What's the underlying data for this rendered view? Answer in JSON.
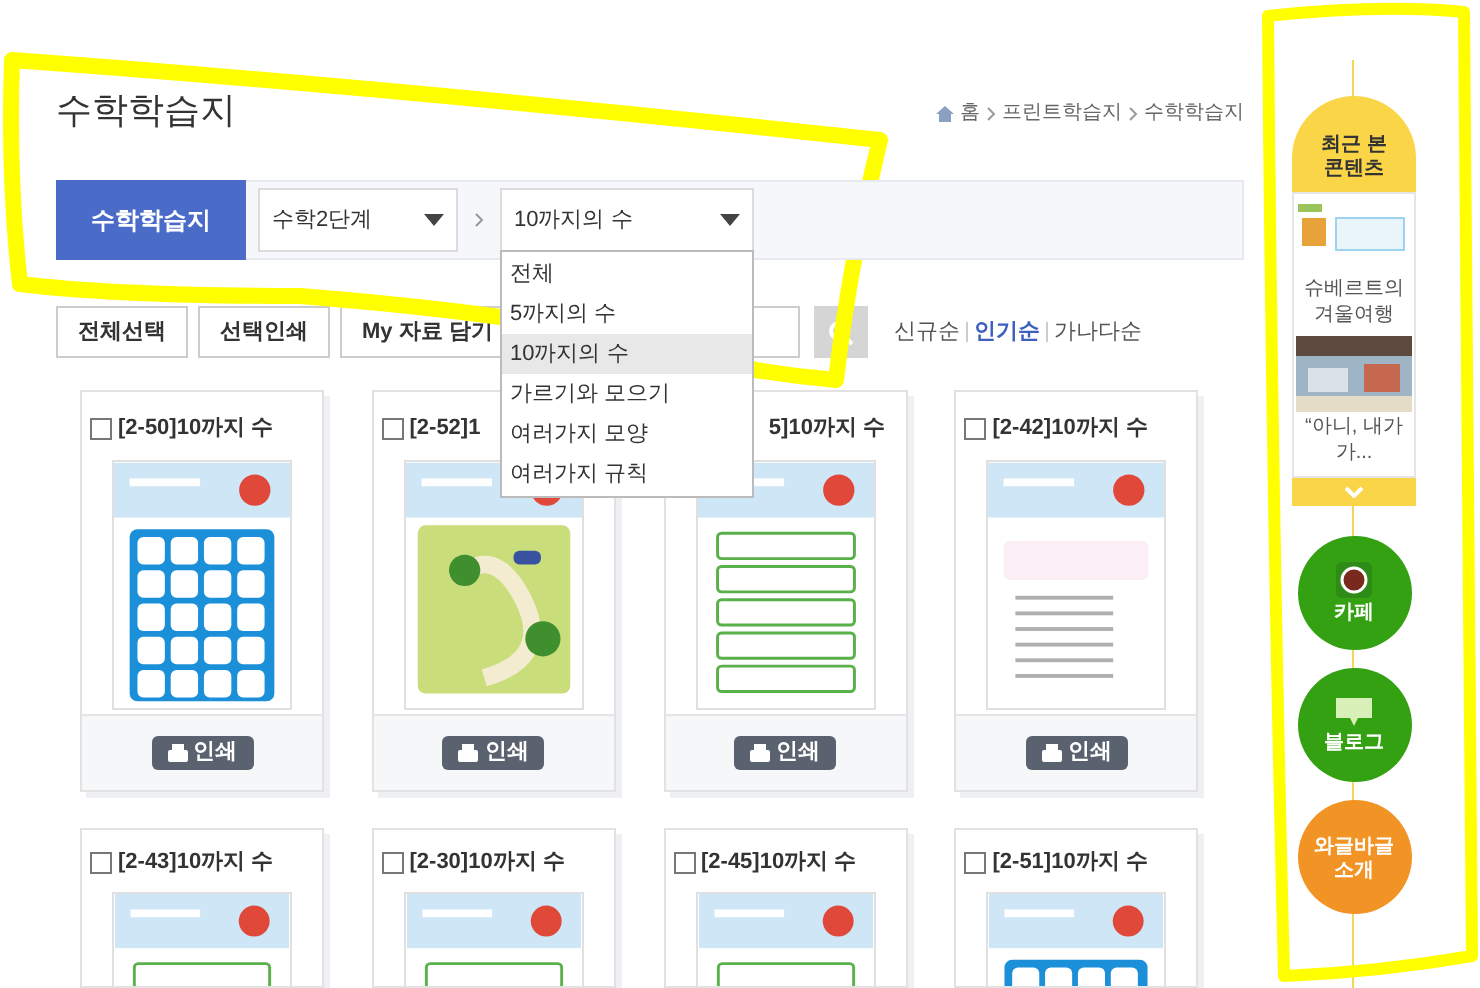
{
  "page_title": "수학학습지",
  "breadcrumb": [
    {
      "label": "홈"
    },
    {
      "label": "프린트학습지"
    },
    {
      "label": "수학학습지"
    }
  ],
  "filter": {
    "category": "수학학습지",
    "level_select": "수학2단계",
    "topic_select": "10까지의 수",
    "topic_options": [
      {
        "label": "전체",
        "selected": false
      },
      {
        "label": "5까지의 수",
        "selected": false
      },
      {
        "label": "10까지의 수",
        "selected": true
      },
      {
        "label": "가르기와 모으기",
        "selected": false
      },
      {
        "label": "여러가지 모양",
        "selected": false
      },
      {
        "label": "여러가지 규칙",
        "selected": false
      }
    ]
  },
  "toolbar": {
    "buttons": [
      "전체선택",
      "선택인쇄",
      "My 자료 담기"
    ]
  },
  "sort": [
    {
      "label": "신규순",
      "selected": false
    },
    {
      "label": "인기순",
      "selected": true
    },
    {
      "label": "가나다순",
      "selected": false
    }
  ],
  "cards": [
    {
      "title": "[2-50]10까지 수",
      "checked": false,
      "print": "인쇄",
      "kind": "grid"
    },
    {
      "title": "[2-52]1",
      "checked": false,
      "print": "인쇄",
      "kind": "map"
    },
    {
      "title": "5]10까지 수",
      "print": "인쇄",
      "kind": "rows"
    },
    {
      "title": "[2-42]10까지 수",
      "checked": false,
      "print": "인쇄",
      "kind": "text"
    },
    {
      "title": "[2-43]10까지 수",
      "checked": false,
      "kind": "rows"
    },
    {
      "title": "[2-30]10까지 수",
      "checked": false,
      "kind": "rows"
    },
    {
      "title": "[2-45]10까지 수",
      "checked": false,
      "kind": "rows"
    },
    {
      "title": "[2-51]10까지 수",
      "checked": false,
      "kind": "grid"
    }
  ],
  "sidebar": {
    "recent_title": "최근 본 콘텐츠",
    "recent": [
      {
        "caption": "슈베르트의 겨울여행"
      },
      {
        "caption": "“아니, 내가 가..."
      }
    ],
    "links": [
      {
        "label": "카페",
        "kind": "cafe"
      },
      {
        "label": "블로그",
        "kind": "blog"
      },
      {
        "label": "와글바글 소개",
        "kind": "intro"
      }
    ]
  }
}
